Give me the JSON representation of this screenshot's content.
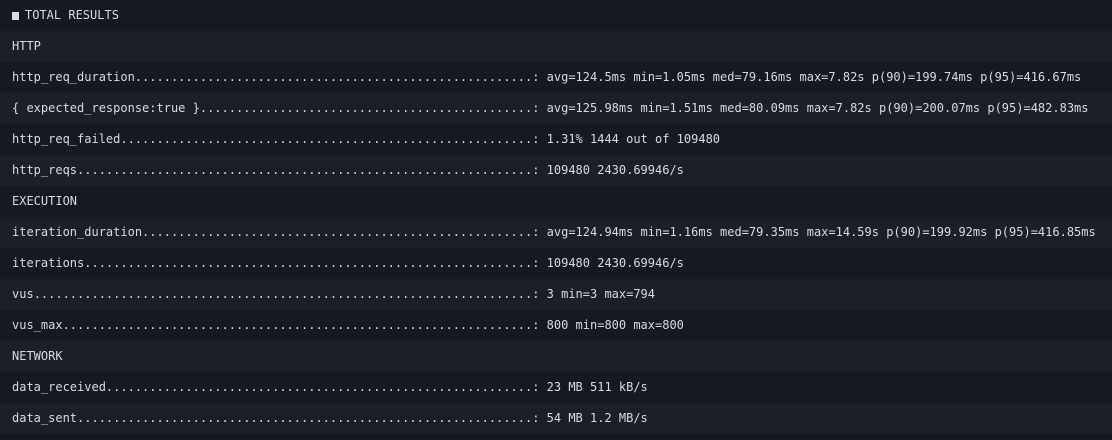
{
  "title": "TOTAL RESULTS",
  "sections": [
    {
      "name": "HTTP",
      "metrics": [
        {
          "label": "http_req_duration",
          "dots": ".......................................................",
          "value": "avg=124.5ms min=1.05ms med=79.16ms max=7.82s p(90)=199.74ms p(95)=416.67ms"
        },
        {
          "label": "{ expected_response:true }",
          "dots": "..............................................",
          "value": "avg=125.98ms min=1.51ms med=80.09ms max=7.82s p(90)=200.07ms p(95)=482.83ms"
        },
        {
          "label": "http_req_failed",
          "dots": ".........................................................",
          "value": "1.31% 1444 out of 109480"
        },
        {
          "label": "http_reqs",
          "dots": "...............................................................",
          "value": "109480 2430.69946/s"
        }
      ]
    },
    {
      "name": "EXECUTION",
      "metrics": [
        {
          "label": "iteration_duration",
          "dots": "......................................................",
          "value": "avg=124.94ms min=1.16ms med=79.35ms max=14.59s p(90)=199.92ms p(95)=416.85ms"
        },
        {
          "label": "iterations",
          "dots": "..............................................................",
          "value": "109480 2430.69946/s"
        },
        {
          "label": "vus",
          "dots": ".....................................................................",
          "value": "3 min=3 max=794"
        },
        {
          "label": "vus_max",
          "dots": ".................................................................",
          "value": "800 min=800 max=800"
        }
      ]
    },
    {
      "name": "NETWORK",
      "metrics": [
        {
          "label": "data_received",
          "dots": "...........................................................",
          "value": "23 MB 511 kB/s"
        },
        {
          "label": "data_sent",
          "dots": "...............................................................",
          "value": "54 MB 1.2 MB/s"
        }
      ]
    }
  ],
  "separator": ": "
}
